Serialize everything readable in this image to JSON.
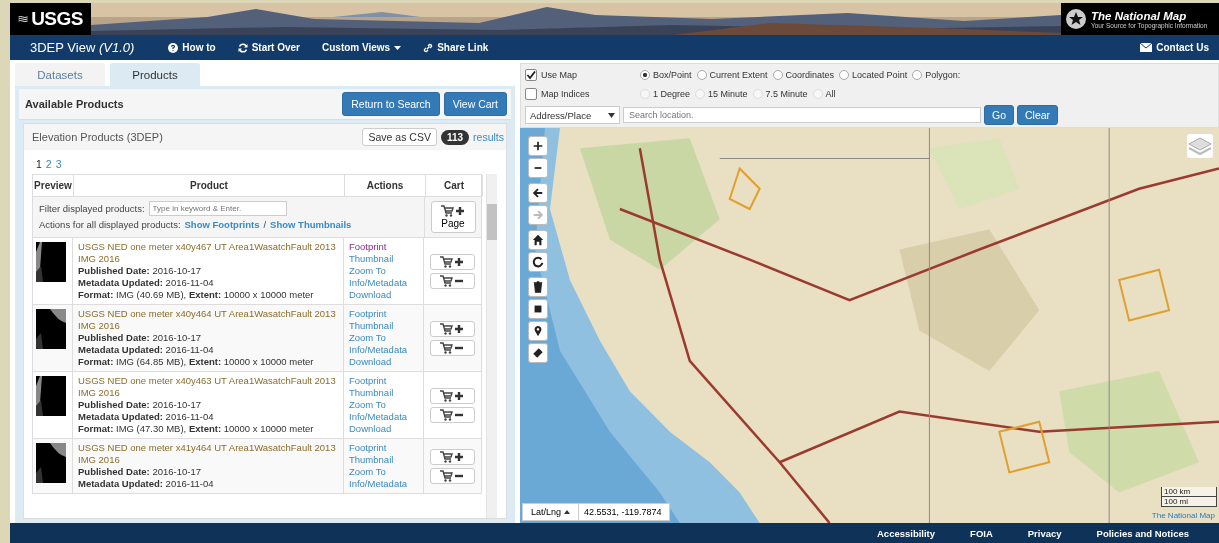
{
  "banner": {
    "logo": "USGS",
    "brand": "The National Map",
    "brand_tagline": "Your Source for Topographic Information"
  },
  "nav": {
    "title": "3DEP View *(V1.0)*",
    "items": [
      {
        "kind": "help",
        "label": "How to"
      },
      {
        "kind": "refresh",
        "label": "Start Over"
      },
      {
        "kind": "dropdown",
        "label": "Custom Views"
      },
      {
        "kind": "link",
        "label": "Share Link"
      }
    ],
    "contact": "Contact Us"
  },
  "tabs": [
    {
      "label": "Datasets",
      "selected": false
    },
    {
      "label": "Products",
      "selected": true
    }
  ],
  "panel": {
    "title": "Available Products",
    "buttons": [
      "Return to Search",
      "View Cart"
    ],
    "section": "Elevation Products (3DEP)",
    "save_button": "Save as CSV",
    "result_count": "113",
    "results_link": "results",
    "pages": [
      {
        "label": "1",
        "selected": true
      },
      {
        "label": "2",
        "selected": false
      },
      {
        "label": "3",
        "selected": false
      }
    ],
    "columns": [
      "Preview",
      "Product",
      "Actions",
      "Cart"
    ],
    "filter_label": "Filter displayed products:",
    "filter_placeholder": "Type in keyword & Enter.",
    "bulk_label": "Actions for all displayed products:",
    "bulk_links": [
      "Show Footprints",
      "Show Thumbnails"
    ],
    "bulk_separator": "/",
    "page_button": "Page",
    "rows": [
      {
        "title": "USGS NED one meter x40y467 UT Area1WasatchFault 2013 IMG 2016",
        "details": [
          "**Published Date:**  2016-10-17",
          "**Metadata Updated:**  2016-11-04",
          "**Format:**  IMG (40.69 MB), **Extent:**  10000 x 10000 meter"
        ],
        "links": [
          {
            "label": "Footprint",
            "visited": true
          },
          {
            "label": "Thumbnail",
            "visited": false
          },
          {
            "label": "Zoom To",
            "visited": false
          },
          {
            "label": "Info/Metadata",
            "visited": false
          },
          {
            "label": "Download",
            "visited": false
          }
        ]
      },
      {
        "title": "USGS NED one meter x40y464 UT Area1WasatchFault 2013 IMG 2016",
        "details": [
          "**Published Date:**  2016-10-17",
          "**Metadata Updated:**  2016-11-04",
          "**Format:**  IMG (64.85 MB), **Extent:**  10000 x 10000 meter"
        ],
        "links": [
          {
            "label": "Footprint",
            "visited": false
          },
          {
            "label": "Thumbnail",
            "visited": false
          },
          {
            "label": "Zoom To",
            "visited": false
          },
          {
            "label": "Info/Metadata",
            "visited": false
          },
          {
            "label": "Download",
            "visited": false
          }
        ]
      },
      {
        "title": "USGS NED one meter x40y463 UT Area1WasatchFault 2013 IMG 2016",
        "details": [
          "**Published Date:**  2016-10-17",
          "**Metadata Updated:**  2016-11-04",
          "**Format:**  IMG (47.30 MB), **Extent:**  10000 x 10000 meter"
        ],
        "links": [
          {
            "label": "Footprint",
            "visited": false
          },
          {
            "label": "Thumbnail",
            "visited": false
          },
          {
            "label": "Zoom To",
            "visited": false
          },
          {
            "label": "Info/Metadata",
            "visited": false
          },
          {
            "label": "Download",
            "visited": false
          }
        ]
      },
      {
        "title": "USGS NED one meter x41y464 UT Area1WasatchFault 2013 IMG 2016",
        "details": [
          "**Published Date:**  2016-10-17",
          "**Metadata Updated:**  2016-11-04"
        ],
        "links": [
          {
            "label": "Footprint",
            "visited": false
          },
          {
            "label": "Thumbnail",
            "visited": false
          },
          {
            "label": "Zoom To",
            "visited": false
          },
          {
            "label": "Info/Metadata",
            "visited": false
          }
        ]
      }
    ]
  },
  "map_options": {
    "checkboxes": [
      {
        "label": "Use Map",
        "checked": true
      },
      {
        "label": "Map Indices",
        "checked": false
      }
    ],
    "extent_radios": [
      {
        "label": "Box/Point",
        "selected": true
      },
      {
        "label": "Current Extent",
        "selected": false
      },
      {
        "label": "Coordinates",
        "selected": false
      },
      {
        "label": "Located Point",
        "selected": false
      },
      {
        "label": "Polygon:",
        "selected": false
      }
    ],
    "index_radios": [
      {
        "label": "1 Degree",
        "selected": false,
        "disabled": true
      },
      {
        "label": "15 Minute",
        "selected": false,
        "disabled": true
      },
      {
        "label": "7.5 Minute",
        "selected": false,
        "disabled": true
      },
      {
        "label": "All",
        "selected": false,
        "disabled": true
      }
    ],
    "search_type": "Address/Place",
    "search_placeholder": "Search location.",
    "buttons": [
      "Go",
      "Clear"
    ]
  },
  "map": {
    "tools": [
      {
        "kind": "zoom-in",
        "disabled": false
      },
      {
        "kind": "zoom-out",
        "disabled": false
      },
      {
        "kind": "back",
        "disabled": false
      },
      {
        "kind": "forward",
        "disabled": true
      },
      {
        "kind": "home",
        "disabled": false
      },
      {
        "kind": "refresh",
        "disabled": false
      },
      {
        "kind": "trash",
        "disabled": false
      },
      {
        "kind": "square",
        "disabled": false
      },
      {
        "kind": "pin",
        "disabled": false
      },
      {
        "kind": "eraser",
        "disabled": false
      }
    ],
    "coord_mode": "Lat/Lng",
    "coordinates": "42.5531, -119.7874",
    "scale": [
      "100 km",
      "100 mi"
    ],
    "attribution": "The National Map"
  },
  "footer": [
    "Accessibility",
    "FOIA",
    "Privacy",
    "Policies and Notices"
  ]
}
